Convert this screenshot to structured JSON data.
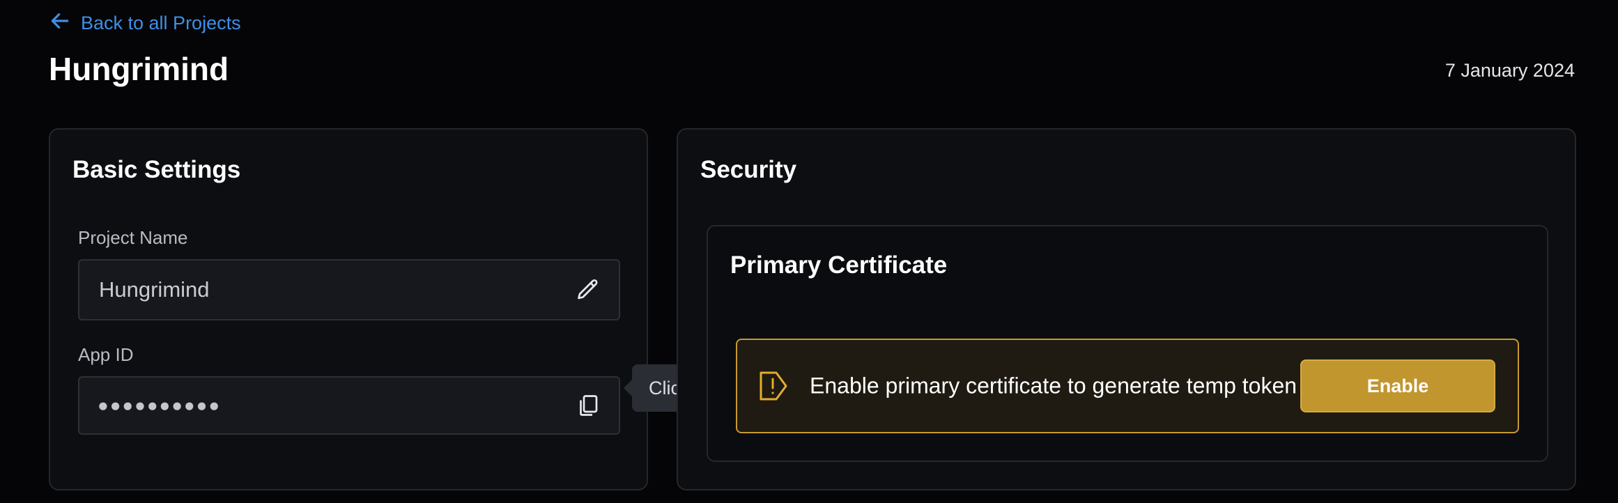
{
  "header": {
    "back_label": "Back to all Projects",
    "title": "Hungrimind",
    "date": "7 January 2024"
  },
  "basic_settings": {
    "title": "Basic Settings",
    "project_name_label": "Project Name",
    "project_name_value": "Hungrimind",
    "app_id_label": "App ID",
    "app_id_value": "●●●●●●●●●●",
    "copy_tooltip": "Click to copy"
  },
  "security": {
    "title": "Security",
    "primary_certificate": {
      "title": "Primary Certificate",
      "alert_text": "Enable primary certificate to generate temp token",
      "enable_label": "Enable"
    }
  },
  "icons": {
    "back": "arrow-left-icon",
    "edit": "pencil-icon",
    "copy": "copy-icon",
    "warning": "warning-icon"
  },
  "colors": {
    "link": "#3f8fe6",
    "accent": "#c1962f",
    "alert_border": "#c89a2e",
    "background": "#050507"
  }
}
